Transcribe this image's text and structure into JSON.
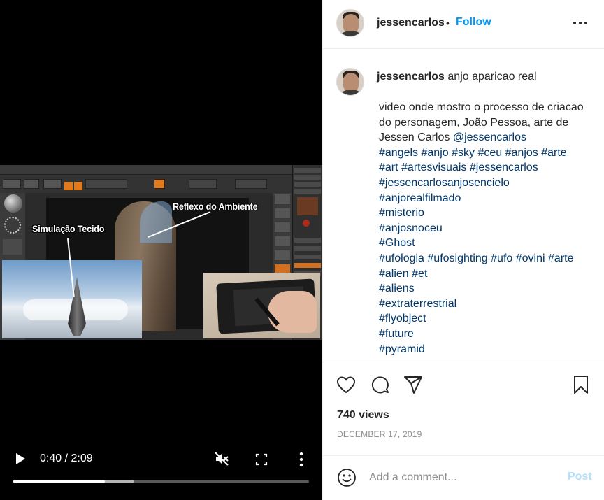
{
  "video": {
    "overlay_labels": {
      "reflexo": "Reflexo do Ambiente",
      "simulacao": "Simulação Tecido"
    },
    "current_time": "0:40",
    "duration": "2:09",
    "time_display": "0:40 / 2:09",
    "progress_fraction": 0.31,
    "buffered_fraction": 0.41,
    "muted": true
  },
  "header": {
    "username": "jessencarlos",
    "separator": "•",
    "follow_label": "Follow"
  },
  "caption": {
    "username": "jessencarlos",
    "title": "anjo aparicao real",
    "text": "video onde mostro o processo de criacao do personagem, João Pessoa, arte de Jessen Carlos",
    "mention": "@jessencarlos",
    "hashtag_lines": [
      [
        "#angels",
        "#anjo",
        "#sky",
        "#ceu",
        "#anjos",
        "#arte"
      ],
      [
        "#art",
        "#artesvisuais",
        "#jessencarlos"
      ],
      [
        "#jessencarlosanjosencielo"
      ],
      [
        "#anjorealfilmado"
      ],
      [
        "#misterio"
      ],
      [
        "#anjosnoceu"
      ],
      [
        "#Ghost"
      ],
      [
        "#ufologia",
        "#ufosighting",
        "#ufo",
        "#ovini",
        "#arte"
      ],
      [
        "#alien",
        "#et"
      ],
      [
        "#aliens"
      ],
      [
        "#extraterrestrial"
      ],
      [
        "#flyobject"
      ],
      [
        "#future"
      ],
      [
        "#pyramid"
      ]
    ]
  },
  "stats": {
    "views": "740 views",
    "date": "DECEMBER 17, 2019"
  },
  "comment_box": {
    "placeholder": "Add a comment...",
    "post_label": "Post"
  },
  "icons": {
    "play": "play-icon",
    "mute": "muted-speaker-icon",
    "fullscreen": "fullscreen-icon",
    "video_more": "vertical-dots-icon",
    "options": "horizontal-dots-icon",
    "like": "heart-icon",
    "comment": "speech-bubble-icon",
    "share": "paper-plane-icon",
    "save": "bookmark-icon",
    "emoji": "smiley-icon"
  },
  "colors": {
    "follow": "#0095f6",
    "hashtag": "#00376b",
    "post_disabled": "#b2dffc",
    "muted_text": "#8e8e8e"
  }
}
